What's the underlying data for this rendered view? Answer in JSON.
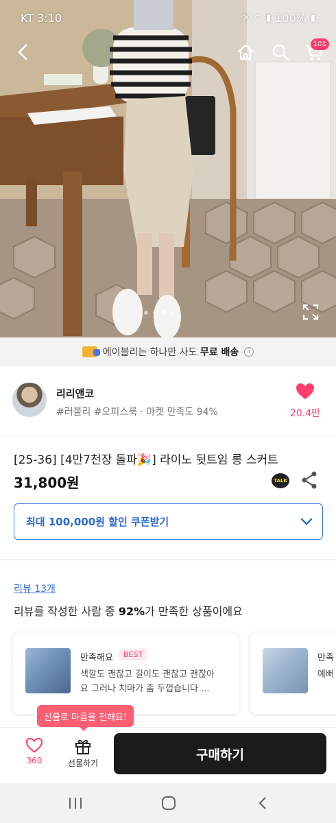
{
  "status_bar": {
    "carrier": "KT",
    "time": "3:10",
    "battery": "100%"
  },
  "header": {
    "cart_count": "101"
  },
  "gallery": {
    "total_images": 4,
    "active_index": 2
  },
  "shipping_banner": {
    "text_before": "에이블리는 하나만 사도 ",
    "highlight": "무료 배송"
  },
  "seller": {
    "name": "리리앤코",
    "tags": "#러블리 #오피스룩 · 마켓 만족도 94%",
    "likes": "20.4만"
  },
  "product": {
    "title": "[25-36] [4만7천장 돌파🎉] 라이노 뒷트임 롱 스커트",
    "price": "31,800원",
    "talk_label": "TALK"
  },
  "coupon": {
    "label": "최대 100,000원 할인 쿠폰받기"
  },
  "reviews": {
    "link_label": "리뷰 13개",
    "summary_before": "리뷰를 작성한 사람 중 ",
    "summary_percent": "92%",
    "summary_after": "가 만족한 상품이에요",
    "cards": [
      {
        "title": "만족해요",
        "badge": "BEST",
        "line1": "색깔도 괜찮고 길이도 괜찮고 괜찮아",
        "line2": "요 그러나 치마가 좀 두껍습니다 ..."
      },
      {
        "title": "만족",
        "badge": "",
        "line1": "예뻐",
        "line2": ""
      }
    ]
  },
  "bottom_bar": {
    "tooltip": "선물로 마음을 전해요!",
    "wish_count": "360",
    "gift_label": "선물하기",
    "buy_label": "구매하기"
  },
  "colors": {
    "accent": "#ff3e6c",
    "link": "#3a6fd8",
    "coupon": "#2a6bd6",
    "buy": "#1b1b1b"
  },
  "icons": [
    "back-arrow-icon",
    "home-icon",
    "search-icon",
    "cart-icon",
    "expand-icon",
    "heart-icon",
    "kakaotalk-icon",
    "share-icon",
    "chevron-down-icon",
    "gift-icon"
  ]
}
